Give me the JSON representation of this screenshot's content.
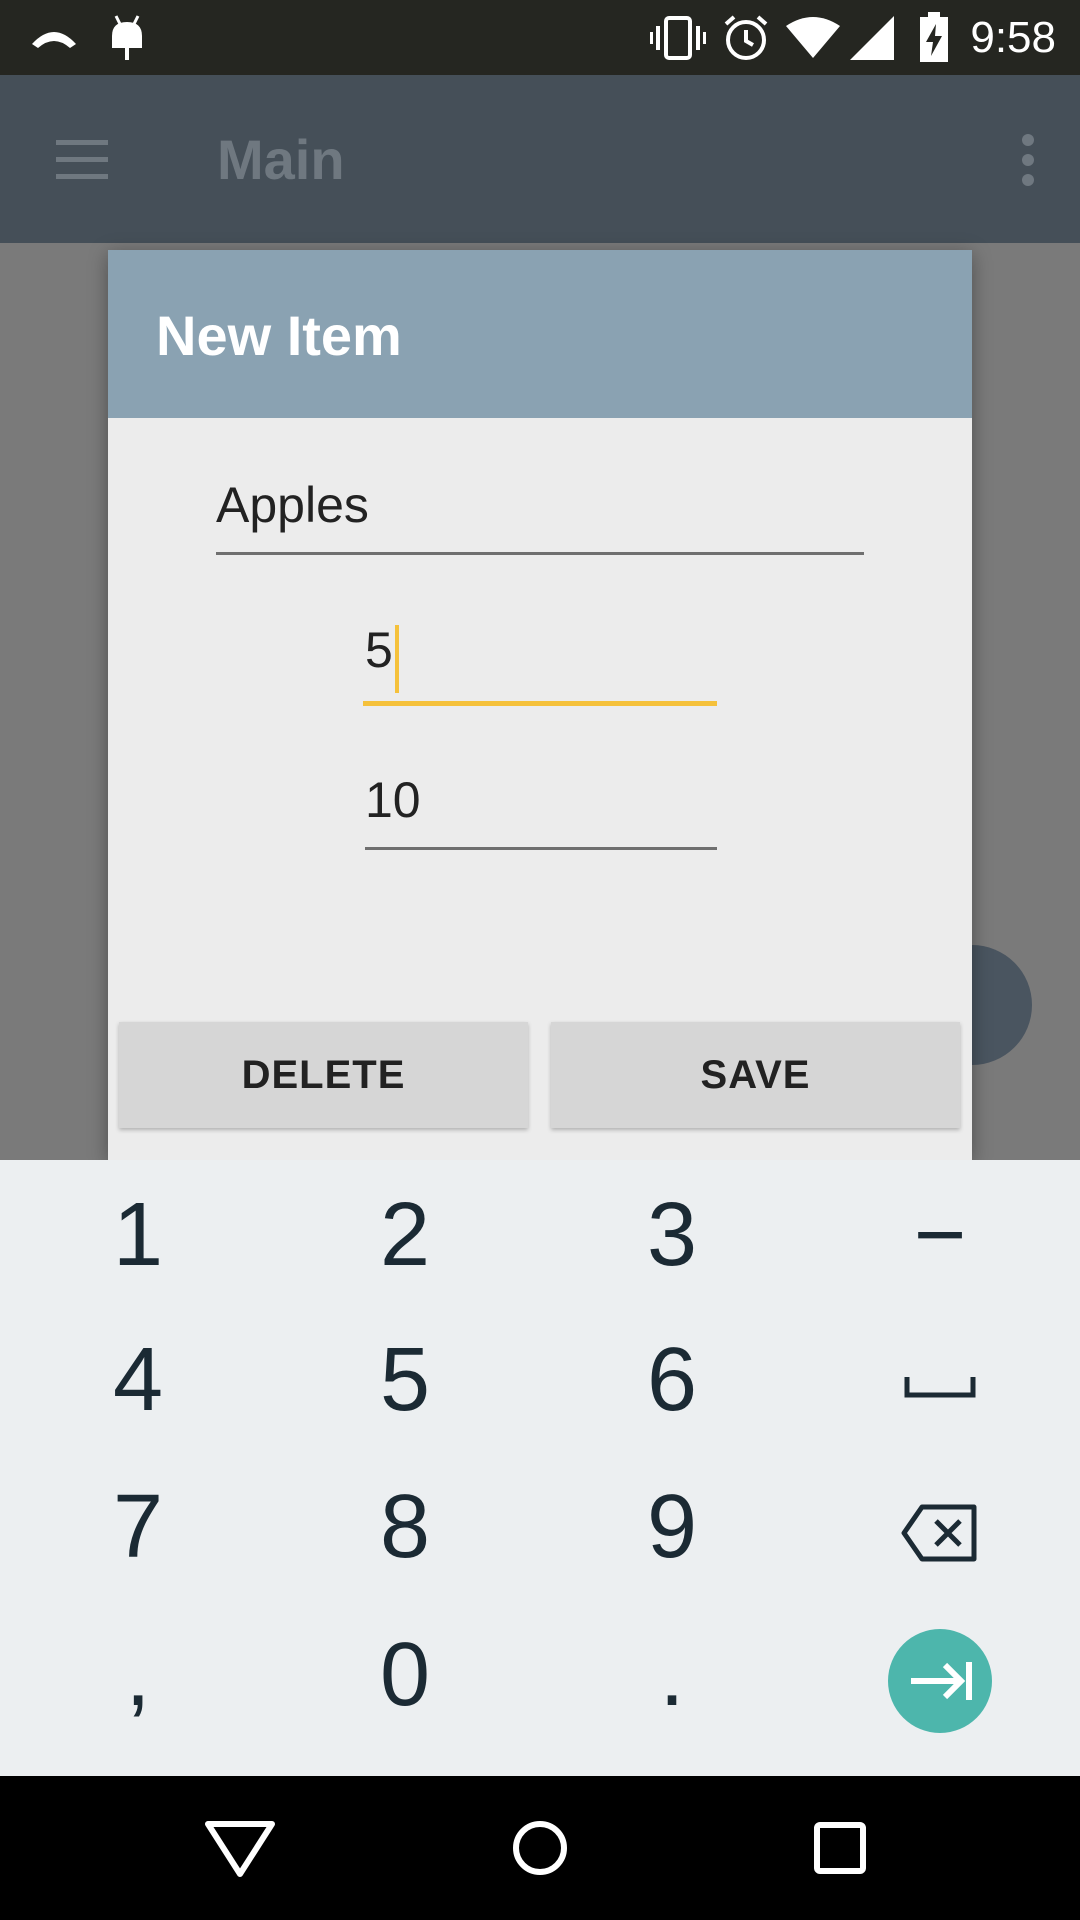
{
  "status_bar": {
    "time": "9:58",
    "icons": [
      "missed-call-icon",
      "android-icon",
      "vibrate-icon",
      "alarm-icon",
      "wifi-icon",
      "signal-icon",
      "battery-charging-icon"
    ]
  },
  "app_bar": {
    "title": "Main",
    "menu_icon": "hamburger-menu-icon",
    "more_icon": "more-vert-icon"
  },
  "dialog": {
    "title": "New Item",
    "fields": [
      {
        "value": "Apples",
        "focused": false
      },
      {
        "value": "5",
        "focused": true
      },
      {
        "value": "10",
        "focused": false
      }
    ],
    "buttons": {
      "delete_label": "DELETE",
      "save_label": "SAVE"
    },
    "accent_color": "#f5c13b",
    "header_color": "#8aa2b2"
  },
  "keyboard": {
    "rows": [
      [
        "1",
        "2",
        "3",
        "−"
      ],
      [
        "4",
        "5",
        "6",
        "space"
      ],
      [
        "7",
        "8",
        "9",
        "backspace"
      ],
      [
        ",",
        "0",
        ".",
        "next"
      ]
    ],
    "next_key_color": "#4db6ac"
  },
  "nav_bar": {
    "icons": [
      "back-icon",
      "home-icon",
      "recents-icon"
    ]
  }
}
